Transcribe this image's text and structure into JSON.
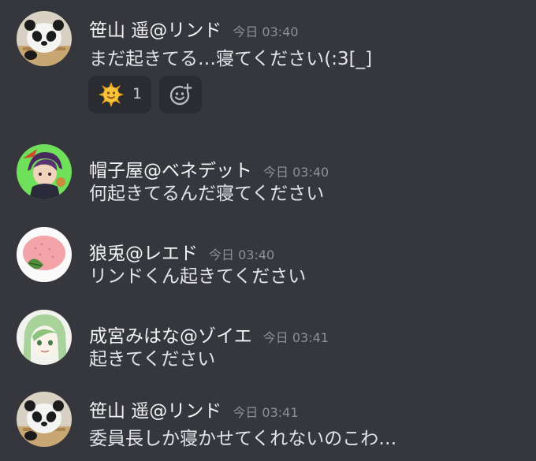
{
  "messages": [
    {
      "user": "笹山 遥@リンド",
      "time": "今日 03:40",
      "text": "まだ起きてる…寝てください(:3[_]"
    },
    {
      "user": "帽子屋@ベネデット",
      "time": "今日 03:40",
      "text": "何起きてるんだ寝てください"
    },
    {
      "user": "狼兎@レエド",
      "time": "今日 03:40",
      "text": "リンドくん起きてください"
    },
    {
      "user": "成宮みはな@ゾイエ",
      "time": "今日 03:41",
      "text": "起きてください"
    },
    {
      "user": "笹山 遥@リンド",
      "time": "今日 03:41",
      "text": "委員長しか寝かせてくれないのこわ…"
    }
  ],
  "reactions": {
    "sun": {
      "emoji": "sun-emoji",
      "count": "1"
    },
    "add": {
      "icon": "add-reaction-icon"
    }
  },
  "colors": {
    "background": "#36373d",
    "username": "#f2f3f5",
    "timestamp": "#8e9097",
    "message_text": "#e3e4e8",
    "reaction_bg": "#2b2c31"
  }
}
